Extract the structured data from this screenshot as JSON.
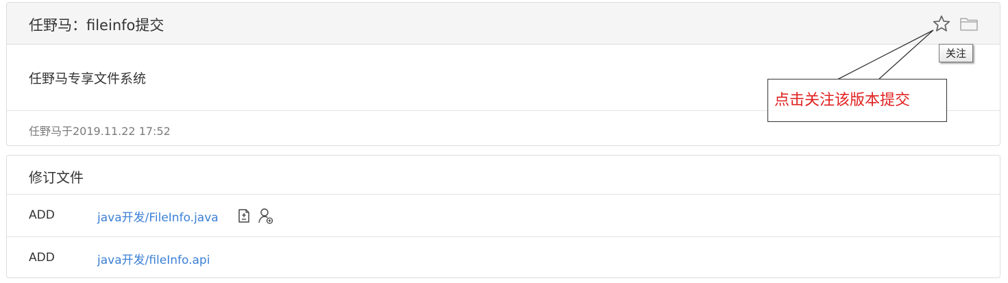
{
  "commit": {
    "title": "任野马：fileinfo提交",
    "message": "任野马专享文件系统",
    "meta": "任野马于2019.11.22 17:52",
    "icons": [
      "star-icon",
      "folder-icon"
    ]
  },
  "tooltip": {
    "label": "关注"
  },
  "annotation": {
    "text": "点击关注该版本提交",
    "color": "#e02020"
  },
  "files": {
    "title": "修订文件",
    "rows": [
      {
        "action": "ADD",
        "path": "java开发/FileInfo.java",
        "icons": [
          "file-compare-icon",
          "user-add-icon"
        ]
      },
      {
        "action": "ADD",
        "path": "java开发/fileInfo.api",
        "icons": []
      }
    ]
  },
  "colors": {
    "link": "#3a7fd5",
    "header_bg": "#f5f5f5",
    "border": "#dcdcdc"
  }
}
